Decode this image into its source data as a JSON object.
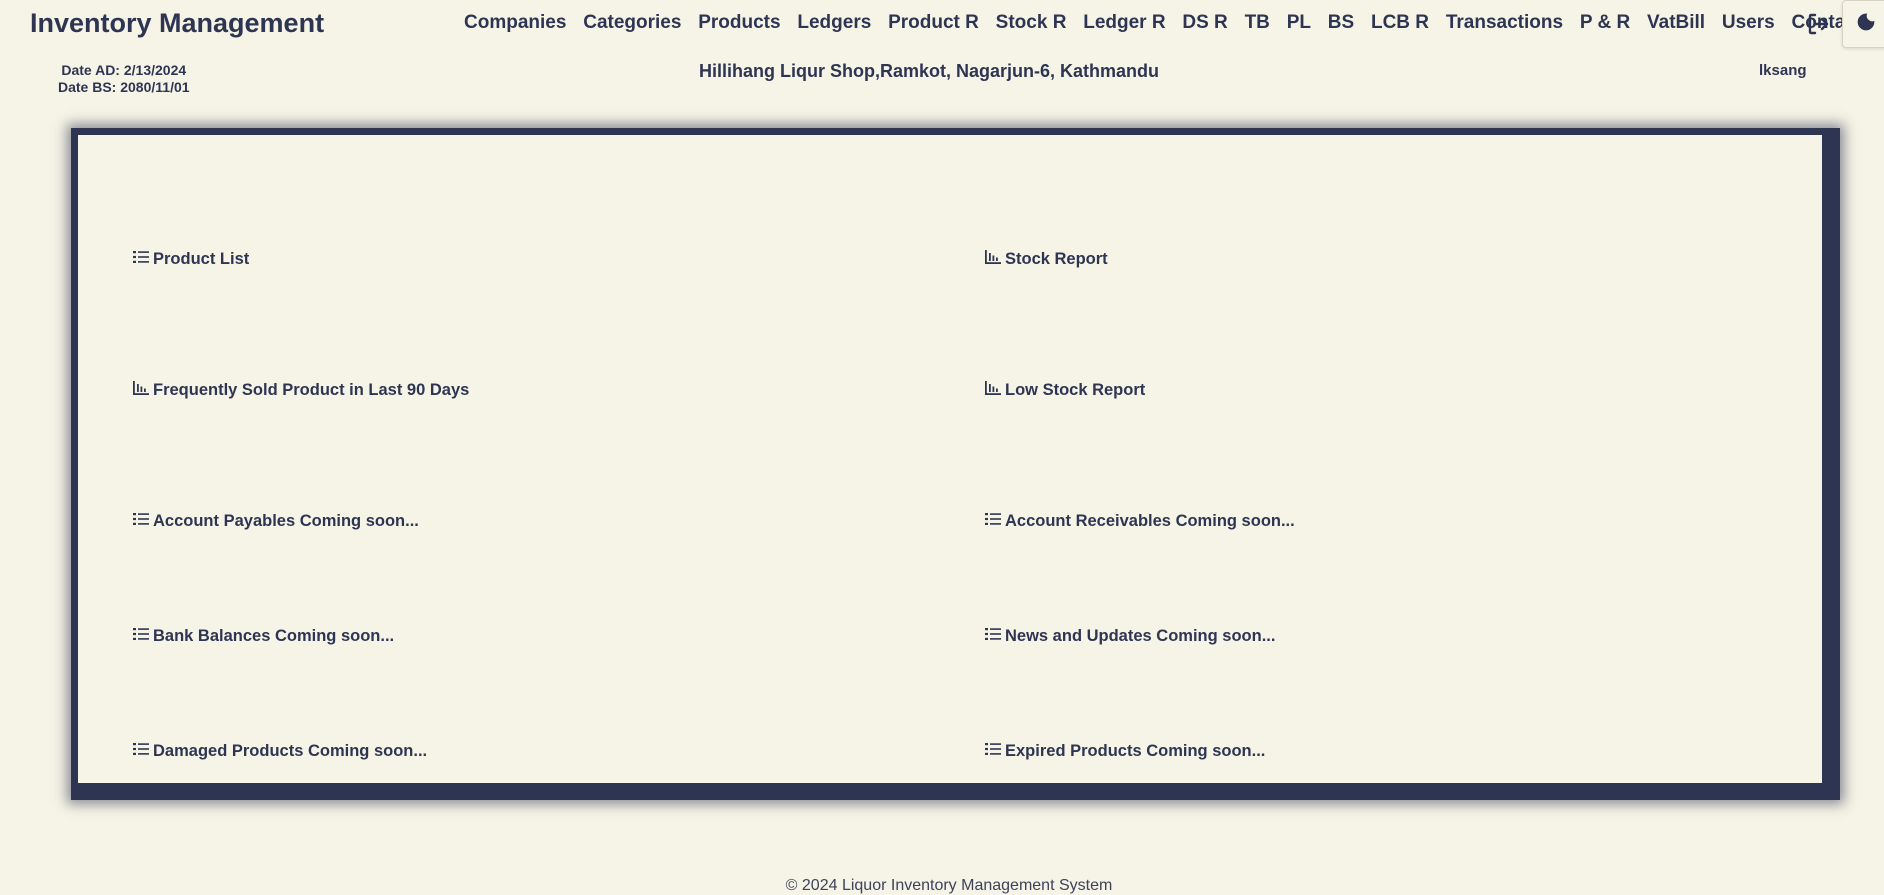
{
  "header": {
    "brand": "Inventory Management",
    "nav": [
      "Companies",
      "Categories",
      "Products",
      "Ledgers",
      "Product R",
      "Stock R",
      "Ledger R",
      "DS R",
      "TB",
      "PL",
      "BS",
      "LCB R",
      "Transactions",
      "P & R",
      "VatBill",
      "Users",
      "Contact"
    ],
    "logout_icon": "logout-icon",
    "theme_icon": "moon-icon"
  },
  "info": {
    "date_ad": "Date AD: 2/13/2024",
    "date_bs": "Date BS: 2080/11/01",
    "shop": "Hillihang Liqur Shop,Ramkot, Nagarjun-6, Kathmandu",
    "user": "lksang"
  },
  "reports": {
    "left": [
      {
        "icon": "list-icon",
        "label": "Product List"
      },
      {
        "icon": "bar-chart-icon",
        "label": "Frequently Sold Product in Last 90 Days"
      },
      {
        "icon": "list-icon",
        "label": "Account Payables Coming soon..."
      },
      {
        "icon": "list-icon",
        "label": "Bank Balances Coming soon..."
      },
      {
        "icon": "list-icon",
        "label": "Damaged Products Coming soon..."
      }
    ],
    "right": [
      {
        "icon": "bar-chart-icon",
        "label": "Stock Report"
      },
      {
        "icon": "bar-chart-icon",
        "label": "Low Stock Report"
      },
      {
        "icon": "list-icon",
        "label": "Account Receivables Coming soon..."
      },
      {
        "icon": "list-icon",
        "label": "News and Updates Coming soon..."
      },
      {
        "icon": "list-icon",
        "label": "Expired Products Coming soon..."
      }
    ]
  },
  "footer": "© 2024 Liquor Inventory Management System",
  "colors": {
    "background": "#f6f4e6",
    "text": "#2e3553",
    "frame": "#2e3553"
  }
}
